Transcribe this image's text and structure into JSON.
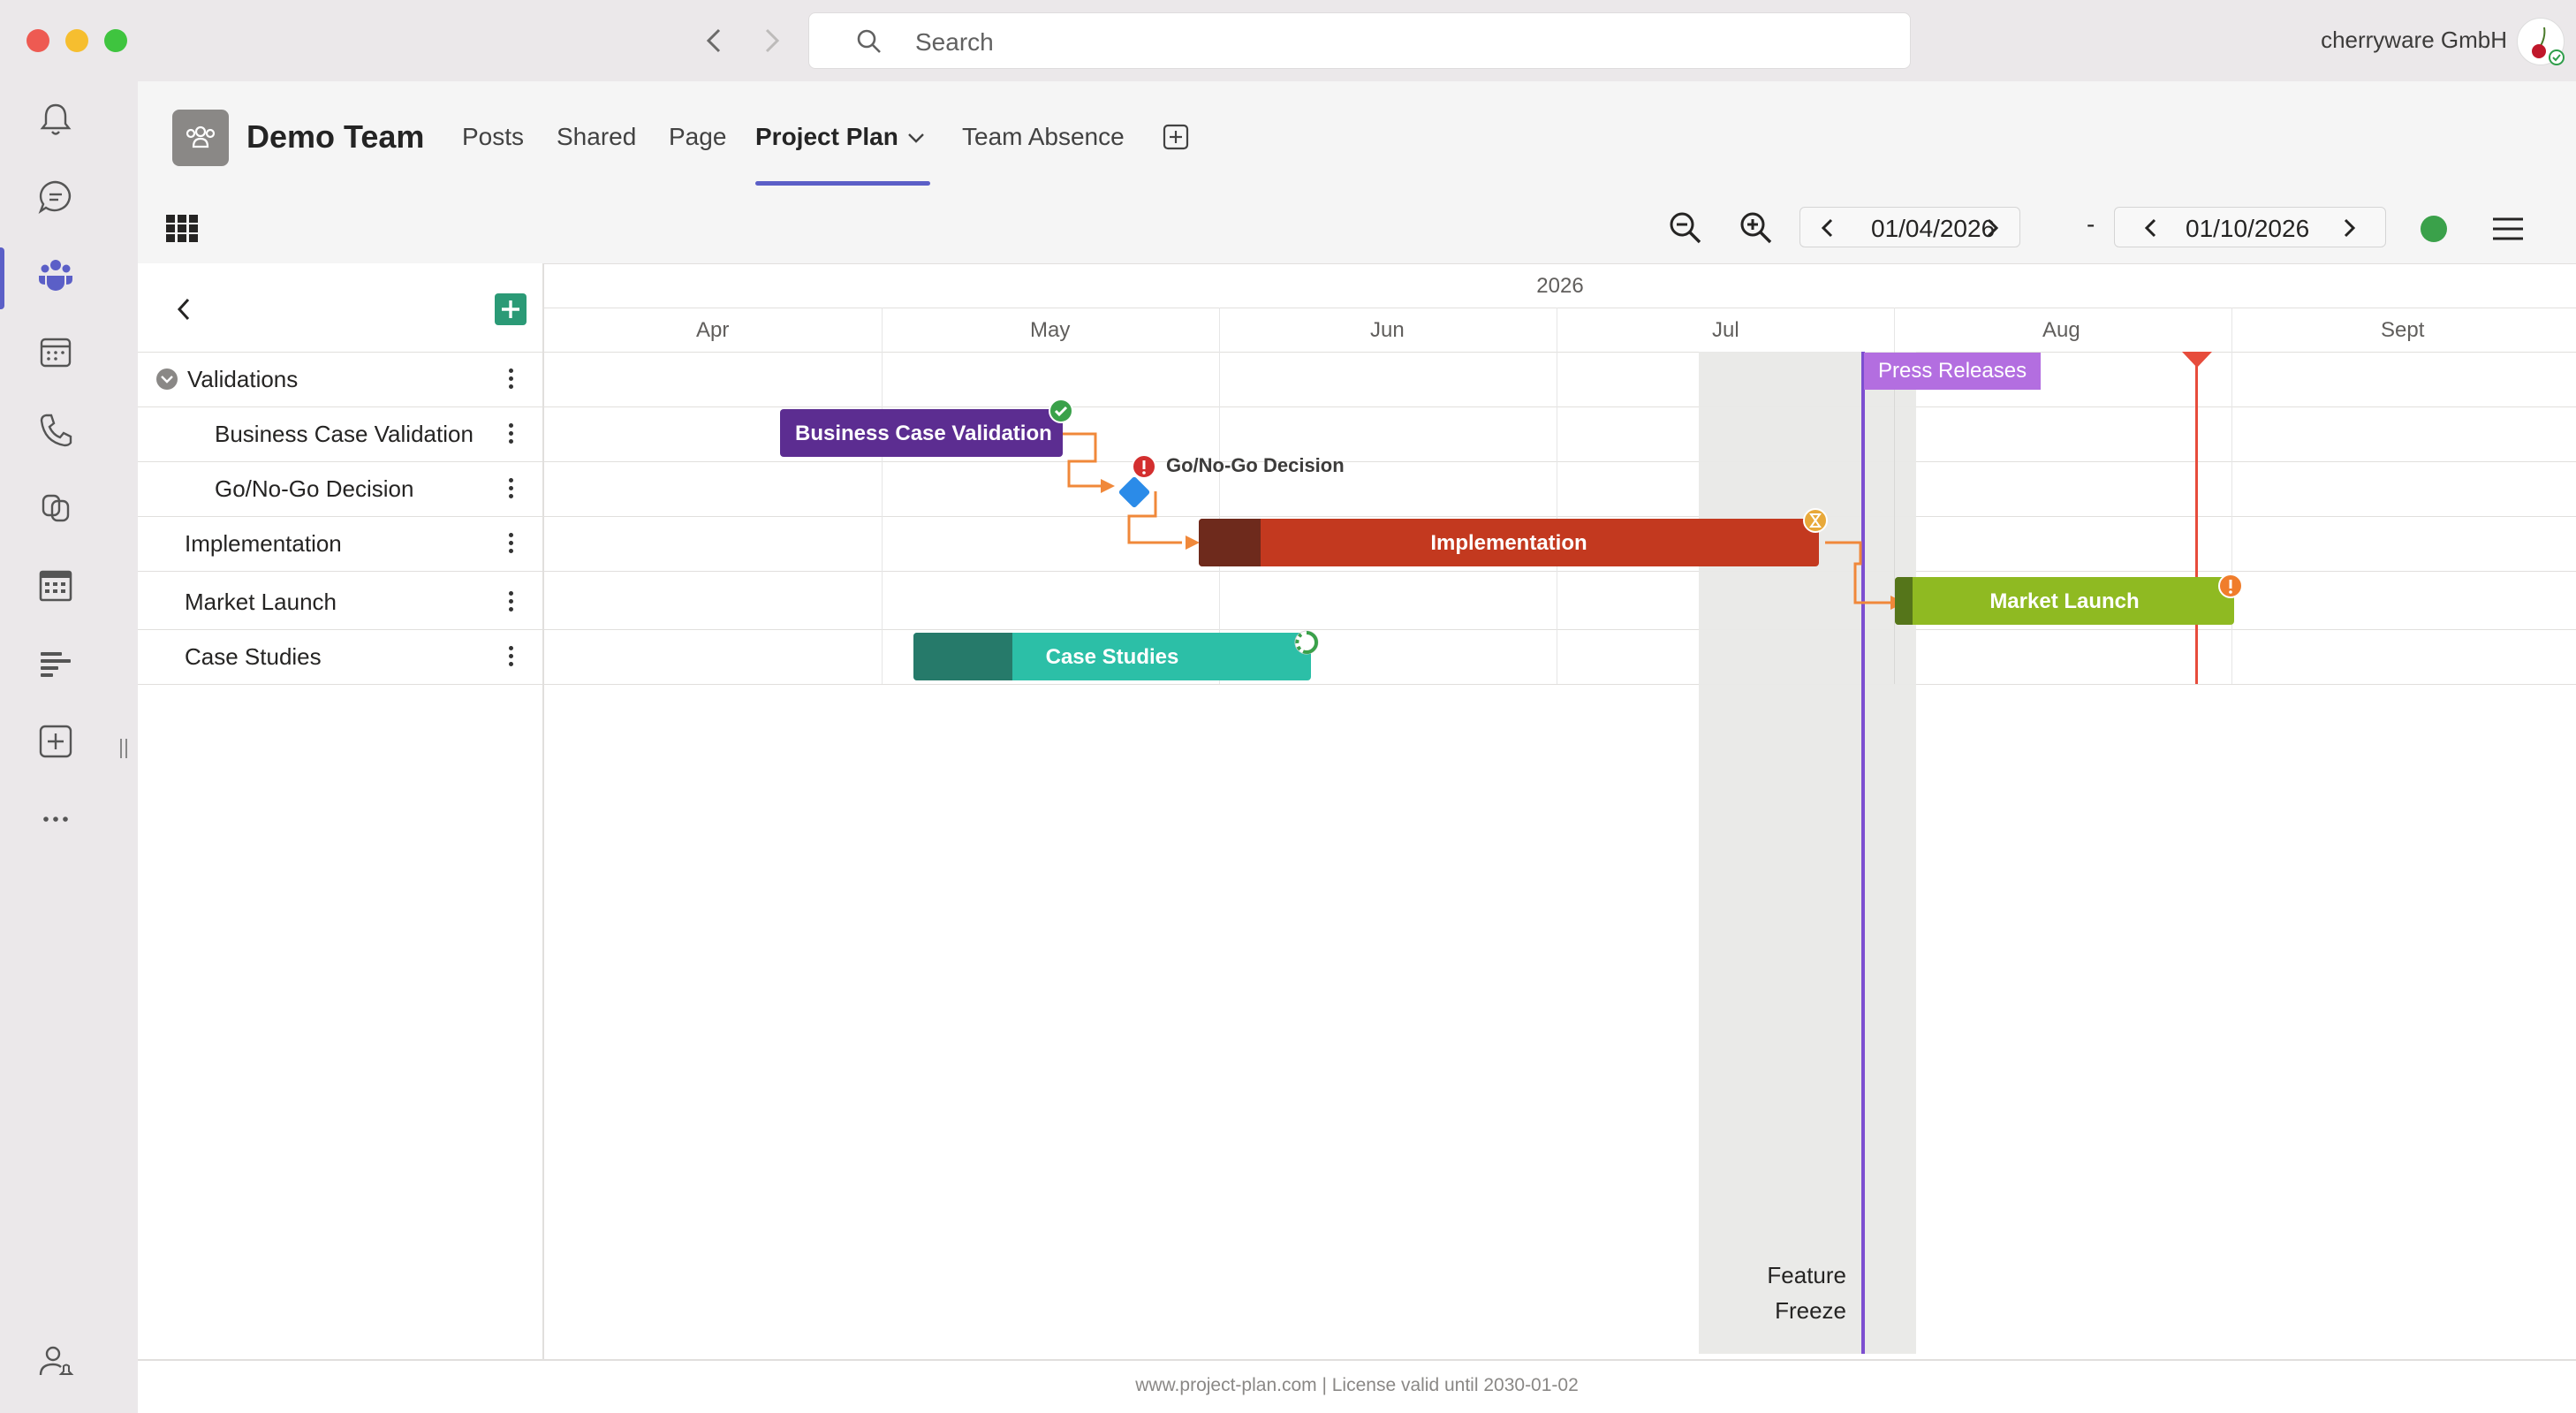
{
  "window": {
    "search_placeholder": "Search",
    "organization": "cherryware GmbH"
  },
  "rail": {
    "icons": [
      "bell-icon",
      "chat-icon",
      "teams-icon",
      "calendar-icon",
      "phone-icon",
      "copilot-icon",
      "planner-icon",
      "gantt-app-icon",
      "add-app-icon",
      "more-icon",
      "account-icon"
    ],
    "active": "teams-icon",
    "accent": "#5b5fc7"
  },
  "team": {
    "name": "Demo Team",
    "tabs": [
      "Posts",
      "Shared",
      "Page",
      "Project Plan",
      "Team Absence"
    ],
    "active_tab": "Project Plan"
  },
  "toolbar": {
    "start_date": "01/04/2026",
    "end_date": "01/10/2026",
    "separator": "-",
    "status_color": "#3aa14a"
  },
  "gantt": {
    "year": "2026",
    "months": [
      "Apr",
      "May",
      "Jun",
      "Jul",
      "Aug",
      "Sept"
    ],
    "tasks": [
      {
        "name": "Validations",
        "type": "group"
      },
      {
        "name": "Business Case Validation",
        "type": "task"
      },
      {
        "name": "Go/No-Go Decision",
        "type": "milestone"
      },
      {
        "name": "Implementation",
        "type": "task"
      },
      {
        "name": "Market Launch",
        "type": "task"
      },
      {
        "name": "Case Studies",
        "type": "task"
      }
    ],
    "bars": {
      "business_case": {
        "label": "Business Case Validation",
        "color": "#5c2d91",
        "status": "done"
      },
      "go_nogo": {
        "label": "Go/No-Go Decision",
        "color": "#2b8be8",
        "status": "alert"
      },
      "implementation": {
        "label": "Implementation",
        "color": "#c3391f",
        "progress_color": "#6e2a1c",
        "status": "waiting",
        "progress": 0.1
      },
      "market_launch": {
        "label": "Market Launch",
        "color": "#8fba22",
        "progress_color": "#55751a",
        "status": "warning",
        "progress": 0.05
      },
      "case_studies": {
        "label": "Case Studies",
        "color": "#2cbfa7",
        "progress_color": "#267a6a",
        "status": "in-progress",
        "progress": 0.25
      }
    },
    "markers": {
      "press_releases": {
        "label": "Press Releases",
        "color": "#9b59d0"
      },
      "feature_freeze": {
        "label_line1": "Feature",
        "label_line2": "Freeze"
      },
      "deadline_color": "#e74c3c"
    }
  },
  "footer": {
    "text": "www.project-plan.com | License valid until 2030-01-02"
  }
}
